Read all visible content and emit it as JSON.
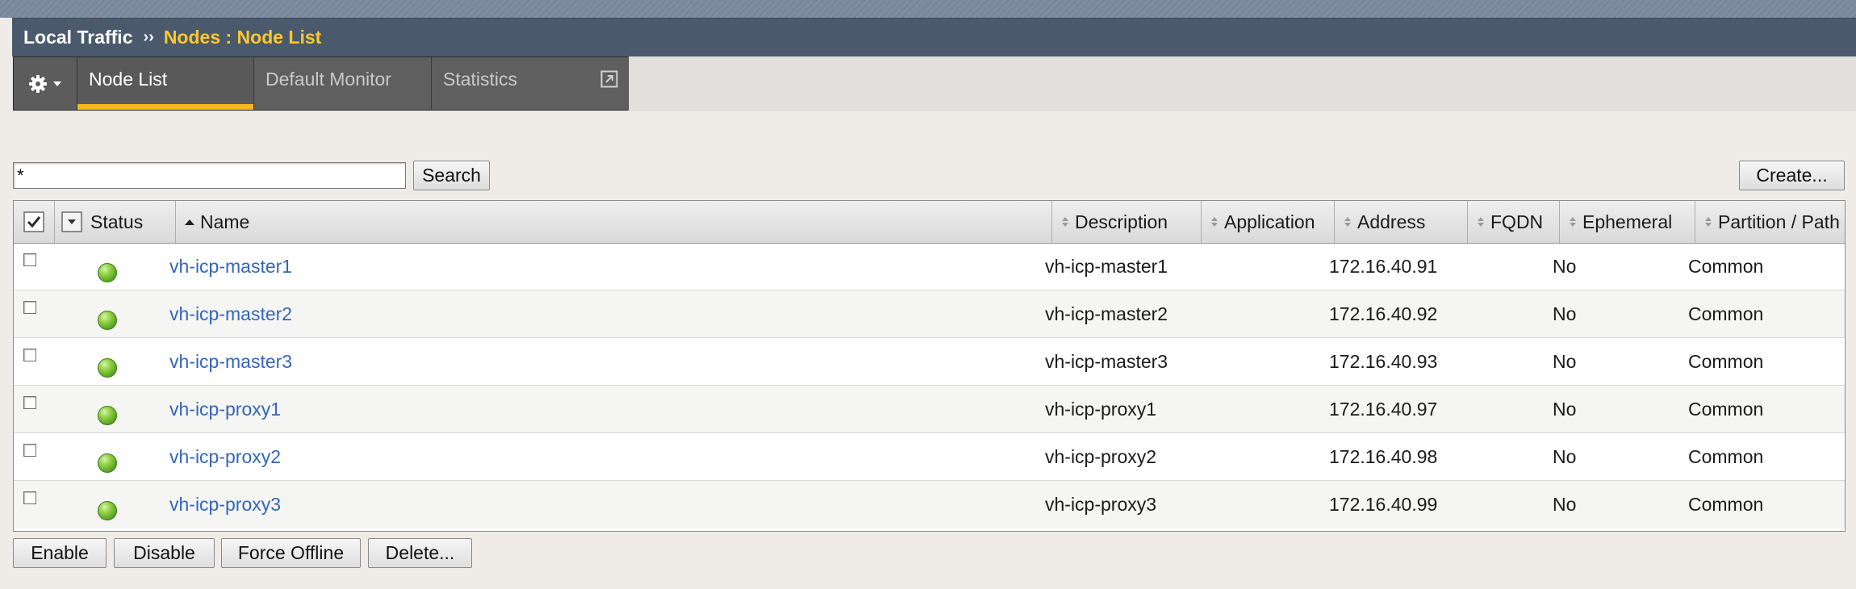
{
  "breadcrumb": {
    "root": "Local Traffic",
    "separator": "››",
    "current": "Nodes : Node List"
  },
  "tabs": [
    {
      "label": "Node List",
      "active": true
    },
    {
      "label": "Default Monitor",
      "active": false
    },
    {
      "label": "Statistics",
      "active": false
    }
  ],
  "icons": {
    "settings": "gear-icon",
    "dropdown": "chevron-down-icon",
    "external": "external-link-icon",
    "status": "status-available-icon"
  },
  "colors": {
    "header_bg": "#4a5a6c",
    "breadcrumb_current": "#ffc72c",
    "active_tab_underline": "#f5b91b",
    "link": "#3366bb",
    "status_green": "#8fd043"
  },
  "search": {
    "value": "*",
    "button_label": "Search"
  },
  "create_button_label": "Create...",
  "table": {
    "columns": {
      "status": "Status",
      "name": "Name",
      "description": "Description",
      "application": "Application",
      "address": "Address",
      "fqdn": "FQDN",
      "ephemeral": "Ephemeral",
      "partition": "Partition / Path"
    },
    "rows": [
      {
        "name": "vh-icp-master1",
        "description": "vh-icp-master1",
        "application": "",
        "address": "172.16.40.91",
        "fqdn": "",
        "ephemeral": "No",
        "partition": "Common"
      },
      {
        "name": "vh-icp-master2",
        "description": "vh-icp-master2",
        "application": "",
        "address": "172.16.40.92",
        "fqdn": "",
        "ephemeral": "No",
        "partition": "Common"
      },
      {
        "name": "vh-icp-master3",
        "description": "vh-icp-master3",
        "application": "",
        "address": "172.16.40.93",
        "fqdn": "",
        "ephemeral": "No",
        "partition": "Common"
      },
      {
        "name": "vh-icp-proxy1",
        "description": "vh-icp-proxy1",
        "application": "",
        "address": "172.16.40.97",
        "fqdn": "",
        "ephemeral": "No",
        "partition": "Common"
      },
      {
        "name": "vh-icp-proxy2",
        "description": "vh-icp-proxy2",
        "application": "",
        "address": "172.16.40.98",
        "fqdn": "",
        "ephemeral": "No",
        "partition": "Common"
      },
      {
        "name": "vh-icp-proxy3",
        "description": "vh-icp-proxy3",
        "application": "",
        "address": "172.16.40.99",
        "fqdn": "",
        "ephemeral": "No",
        "partition": "Common"
      }
    ]
  },
  "actions": {
    "enable": "Enable",
    "disable": "Disable",
    "force_offline": "Force Offline",
    "delete": "Delete..."
  }
}
